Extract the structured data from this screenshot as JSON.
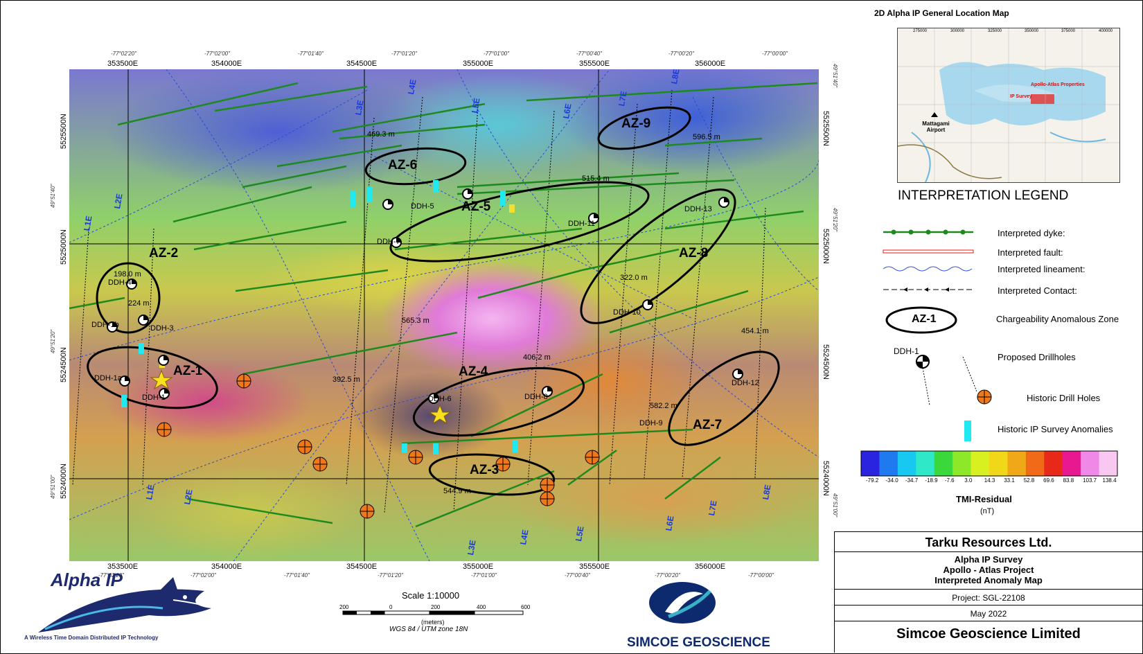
{
  "easting_ticks_top": [
    "353500E",
    "354000E",
    "354500E",
    "355000E",
    "355500E",
    "356000E"
  ],
  "easting_ticks_bottom": [
    "353500E",
    "354000E",
    "354500E",
    "355000E",
    "355500E",
    "356000E"
  ],
  "dms_top": [
    "-77°02'20\"",
    "-77°02'00\"",
    "-77°01'40\"",
    "-77°01'20\"",
    "-77°01'00\"",
    "-77°00'40\"",
    "-77°00'20\"",
    "-77°00'00\""
  ],
  "dms_bottom": [
    "-77°02'20\"",
    "-77°02'00\"",
    "-77°01'40\"",
    "-77°01'20\"",
    "-77°01'00\"",
    "-77°00'40\"",
    "-77°00'20\"",
    "-77°00'00\""
  ],
  "northing_left": [
    "5525500N",
    "5525000N",
    "5524500N",
    "5524000N"
  ],
  "northing_right": [
    "5525500N",
    "5525000N",
    "5524500N",
    "5524000N"
  ],
  "lat_left": [
    "49°51'40\"",
    "49°51'20\"",
    "49°51'00\""
  ],
  "lat_right": [
    "49°51'40\"",
    "49°51'20\"",
    "49°51'00\""
  ],
  "zones": [
    "AZ-1",
    "AZ-2",
    "AZ-3",
    "AZ-4",
    "AZ-5",
    "AZ-6",
    "AZ-7",
    "AZ-8",
    "AZ-9"
  ],
  "survey_lines": [
    "L1E",
    "L2E",
    "L3E",
    "L4E",
    "L5E",
    "L6E",
    "L7E",
    "L8E"
  ],
  "drillholes": [
    "DDH-1",
    "DDH-1a",
    "DDH-1b",
    "DDH-2",
    "DDH-3",
    "DDH-4",
    "DDH-5",
    "DDH-6",
    "DDH-7",
    "DDH-8",
    "DDH-9",
    "DDH-10",
    "DDH-11",
    "DDH-12",
    "DDH-13"
  ],
  "distances": [
    "469.3 m",
    "515.4 m",
    "198.0 m",
    "224 m",
    "565.3 m",
    "322.0 m",
    "406.2 m",
    "454.1 m",
    "582.2 m",
    "544.9 m",
    "596.5 m",
    "392.5 m"
  ],
  "location_map": {
    "title": "2D Alpha IP General Location Map",
    "places": [
      "Mattagami Airport",
      "Apollo-Atlas Properties",
      "IP Survey"
    ],
    "ticks": [
      "275000",
      "300000",
      "325000",
      "350000",
      "375000",
      "400000"
    ]
  },
  "legend": {
    "title": "INTERPRETATION LEGEND",
    "items": [
      "Interpreted dyke:",
      "Interpreted fault:",
      "Interpreted lineament:",
      "Interpreted Contact:",
      "Chargeability Anomalous Zone",
      "Proposed Drillholes",
      "Historic Drill Holes",
      "Historic IP Survey Anomalies"
    ],
    "zone_sample": "AZ-1",
    "ddh_sample": "DDH-1"
  },
  "colorbar": {
    "labels": [
      "-79.2",
      "-34.0",
      "-34.7",
      "-18.9",
      "-7.6",
      "3.0",
      "14.3",
      "33.1",
      "52.8",
      "69.6",
      "83.8",
      "103.7",
      "138.4"
    ],
    "title": "TMI-Residual",
    "unit": "(nT)",
    "colors": [
      "#2a24e0",
      "#1f7af0",
      "#18c8f0",
      "#2ee8c8",
      "#3ad83a",
      "#8ee82a",
      "#d8f020",
      "#f0d818",
      "#f0a818",
      "#f06a18",
      "#e82818",
      "#e81890",
      "#f088e8",
      "#f8c8f0"
    ]
  },
  "scale": {
    "title": "Scale 1:10000",
    "ticks": [
      "200",
      "0",
      "200",
      "400",
      "600"
    ],
    "unit": "(meters)",
    "datum": "WGS 84 / UTM zone 18N"
  },
  "alpha_logo": {
    "name": "Alpha IP",
    "tagline": "A Wireless Time Domain Distributed IP Technology"
  },
  "simcoe_logo": {
    "name": "SIMCOE GEOSCIENCE"
  },
  "title_block": {
    "company": "Tarku Resources Ltd.",
    "line1": "Alpha IP Survey",
    "line2": "Apollo - Atlas Project",
    "line3": "Interpreted Anomaly Map",
    "project": "Project: SGL-22108",
    "date": "May 2022",
    "author": "Simcoe Geoscience Limited"
  }
}
